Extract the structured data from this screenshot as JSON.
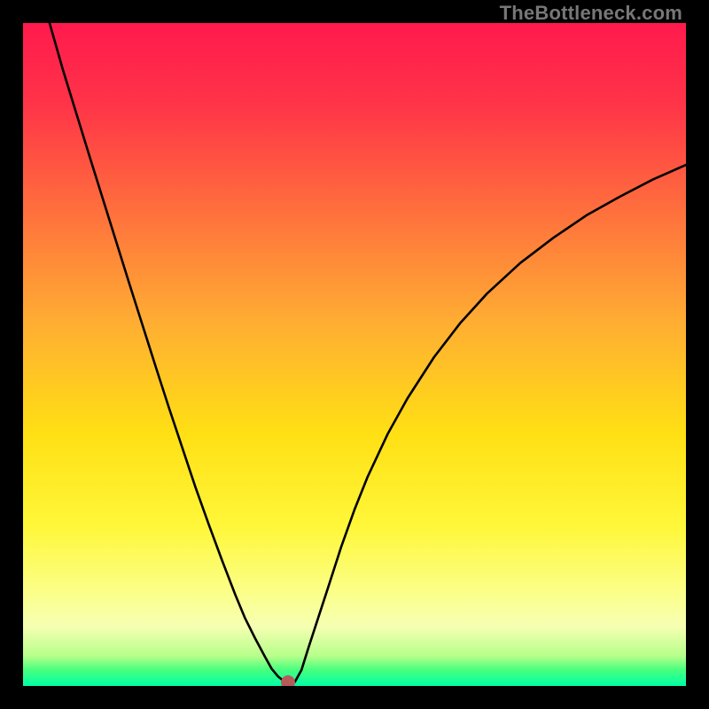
{
  "watermark": "TheBottleneck.com",
  "colors": {
    "frame": "#000000",
    "curve": "#000000",
    "marker": "#b85a5a",
    "gradient_stops": [
      {
        "offset": 0.0,
        "color": "#ff1a4d"
      },
      {
        "offset": 0.12,
        "color": "#ff3348"
      },
      {
        "offset": 0.28,
        "color": "#ff6e3d"
      },
      {
        "offset": 0.45,
        "color": "#ffad33"
      },
      {
        "offset": 0.62,
        "color": "#ffe014"
      },
      {
        "offset": 0.76,
        "color": "#fff73a"
      },
      {
        "offset": 0.86,
        "color": "#fbff8a"
      },
      {
        "offset": 0.91,
        "color": "#f6ffb2"
      },
      {
        "offset": 0.955,
        "color": "#b6ff8a"
      },
      {
        "offset": 0.975,
        "color": "#4bff7e"
      },
      {
        "offset": 1.0,
        "color": "#00ffa5"
      }
    ]
  },
  "chart_data": {
    "type": "line",
    "title": "",
    "xlabel": "",
    "ylabel": "",
    "xlim": [
      0,
      100
    ],
    "ylim": [
      0,
      100
    ],
    "grid": false,
    "legend": false,
    "series": [
      {
        "name": "bottleneck-curve",
        "x": [
          4,
          6,
          8,
          10,
          12,
          14,
          16,
          18,
          20,
          22,
          24,
          26,
          28,
          30,
          32,
          33.5,
          35,
          36.5,
          37.5,
          38.5,
          39.5,
          40,
          41,
          42,
          43,
          44.5,
          46,
          48,
          50,
          52,
          55,
          58,
          62,
          66,
          70,
          75,
          80,
          85,
          90,
          95,
          100
        ],
        "y": [
          100,
          93,
          86.5,
          80,
          73.6,
          67.2,
          60.8,
          54.5,
          48.2,
          42,
          36,
          30,
          24.4,
          19,
          13.8,
          10.2,
          7.2,
          4.4,
          2.6,
          1.4,
          0.6,
          0.3,
          0.6,
          2.4,
          5.6,
          10.2,
          14.8,
          21,
          26.6,
          31.6,
          38,
          43.4,
          49.6,
          54.8,
          59.2,
          63.8,
          67.6,
          71,
          73.8,
          76.4,
          78.6
        ]
      }
    ],
    "annotations": [
      {
        "name": "min-marker",
        "x": 40,
        "y": 0.5,
        "color": "#b85a5a"
      }
    ]
  }
}
